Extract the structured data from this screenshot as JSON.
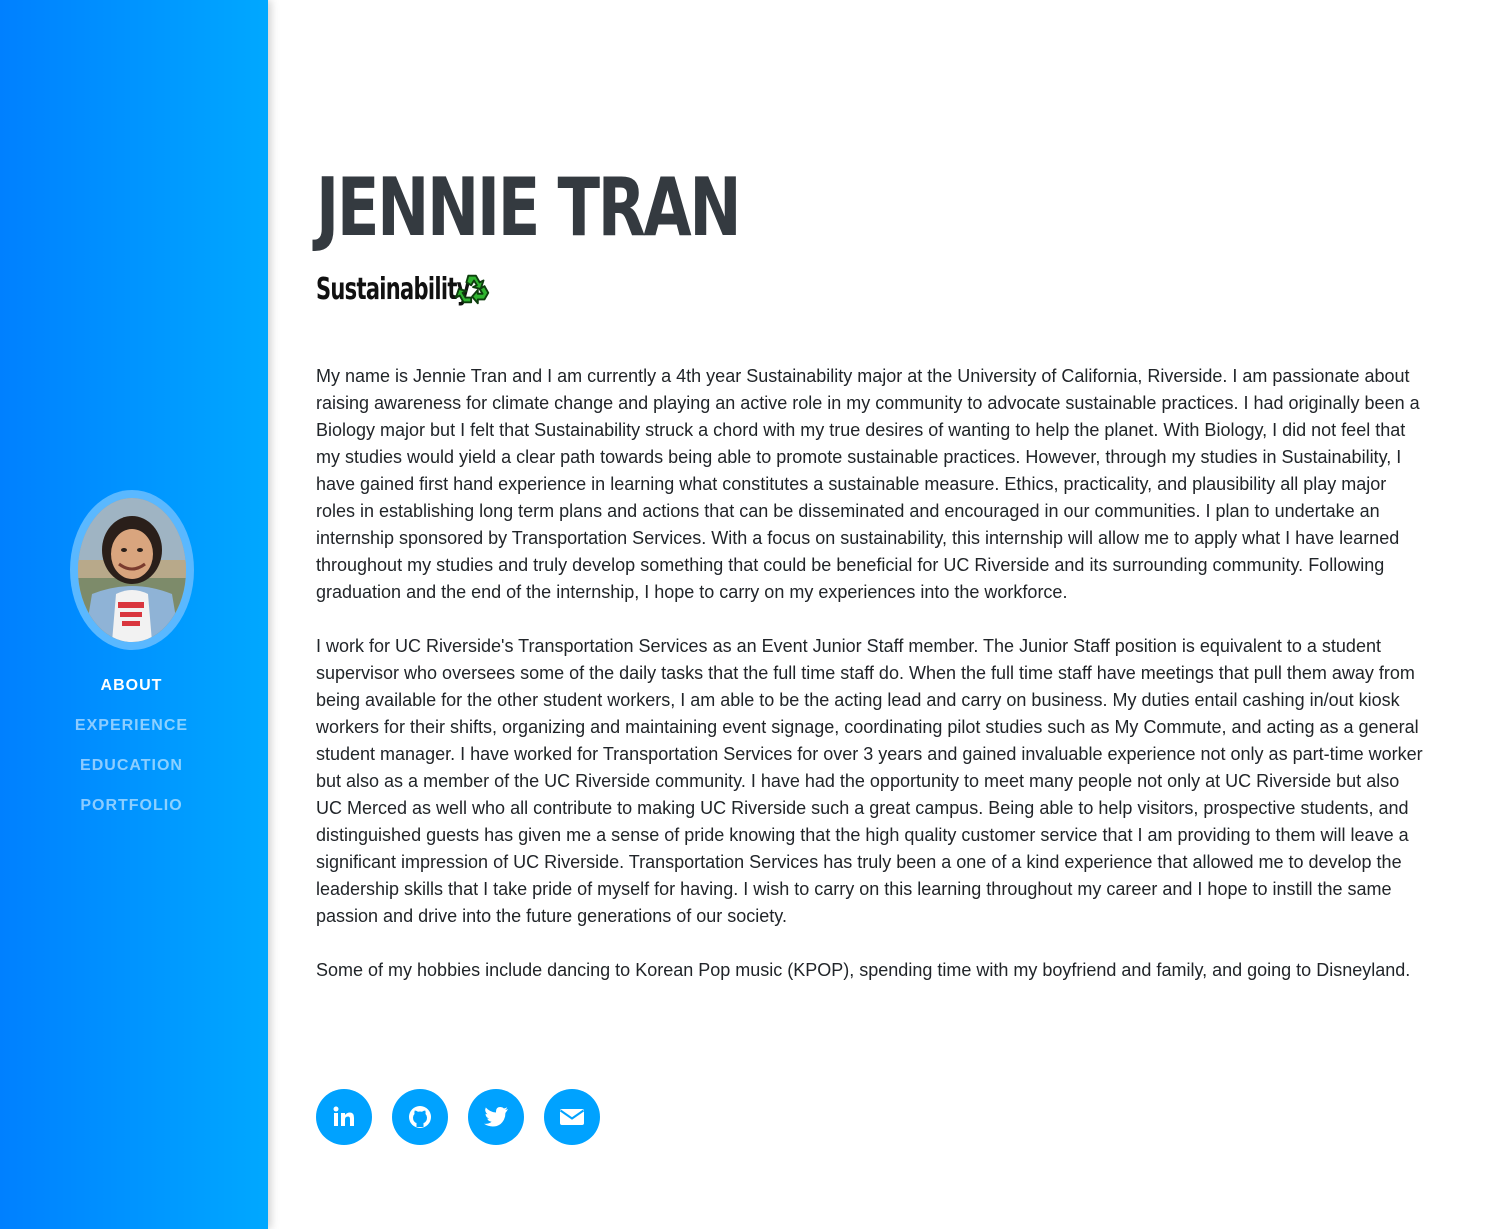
{
  "profile": {
    "name": "JENNIE TRAN",
    "subtitle": "Sustainability",
    "avatar_alt": "profile photo"
  },
  "nav": {
    "items": [
      {
        "label": "ABOUT",
        "active": true
      },
      {
        "label": "EXPERIENCE",
        "active": false
      },
      {
        "label": "EDUCATION",
        "active": false
      },
      {
        "label": "PORTFOLIO",
        "active": false
      }
    ]
  },
  "about": {
    "paragraphs": [
      "My name is Jennie Tran and I am currently a 4th year Sustainability major at the University of California, Riverside. I am passionate about raising awareness for climate change and playing an active role in my community to advocate sustainable practices. I had originally been a Biology major but I felt that Sustainability struck a chord with my true desires of wanting to help the planet. With Biology, I did not feel that my studies would yield a clear path towards being able to promote sustainable practices. However, through my studies in Sustainability, I have gained first hand experience in learning what constitutes a sustainable measure. Ethics, practicality, and plausibility all play major roles in establishing long term plans and actions that can be disseminated and encouraged in our communities. I plan to undertake an internship sponsored by Transportation Services. With a focus on sustainability, this internship will allow me to apply what I have learned throughout my studies and truly develop something that could be beneficial for UC Riverside and its surrounding community. Following graduation and the end of the internship, I hope to carry on my experiences into the workforce.",
      "I work for UC Riverside's Transportation Services as an Event Junior Staff member. The Junior Staff position is equivalent to a student supervisor who oversees some of the daily tasks that the full time staff do. When the full time staff have meetings that pull them away from being available for the other student workers, I am able to be the acting lead and carry on business. My duties entail cashing in/out kiosk workers for their shifts, organizing and maintaining event signage, coordinating pilot studies such as My Commute, and acting as a general student manager. I have worked for Transportation Services for over 3 years and gained invaluable experience not only as part-time worker but also as a member of the UC Riverside community. I have had the opportunity to meet many people not only at UC Riverside but also UC Merced as well who all contribute to making UC Riverside such a great campus. Being able to help visitors, prospective students, and distinguished guests has given me a sense of pride knowing that the high quality customer service that I am providing to them will leave a significant impression of UC Riverside. Transportation Services has truly been a one of a kind experience that allowed me to develop the leadership skills that I take pride of myself for having. I wish to carry on this learning throughout my career and I hope to instill the same passion and drive into the future generations of our society.",
      "Some of my hobbies include dancing to Korean Pop music (KPOP), spending time with my boyfriend and family, and going to Disneyland."
    ]
  },
  "socials": [
    {
      "icon": "linkedin-icon"
    },
    {
      "icon": "github-icon"
    },
    {
      "icon": "twitter-icon"
    },
    {
      "icon": "envelope-icon"
    }
  ],
  "colors": {
    "sidebar_start": "#0080ff",
    "sidebar_end": "#00a8ff",
    "accent": "#00a2ff",
    "heading": "#343a40",
    "text": "#212529"
  }
}
